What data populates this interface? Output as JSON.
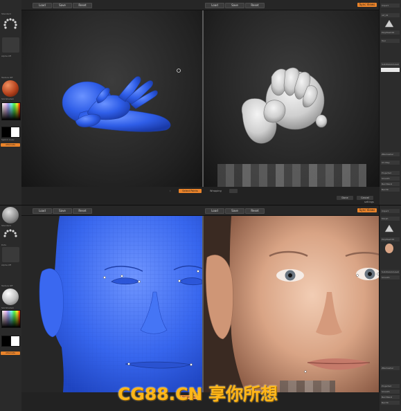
{
  "panels": [
    {
      "left_shelf": {
        "label_a": "Standard",
        "label_b": "Alpha Off",
        "label_c": "Texture Off",
        "label_d": "SkinShade4",
        "label_e": "Switch Color",
        "button": "Alternate"
      },
      "toolbar": {
        "load_a": "Load",
        "save_a": "Save",
        "reset_a": "Reset",
        "load_b": "Load",
        "save_b": "Save",
        "reset_b": "Reset",
        "sync": "Sync Views"
      },
      "bottombar": {
        "select_points": "Select Points",
        "wrapping": "Wrapping",
        "done": "Done",
        "cancel": "Cancel",
        "extra_a": "settings",
        "extra_b": "Wireframe"
      },
      "right_shelf": {
        "r1": "Import",
        "r2": "ref_02",
        "r3": "PolyMesh3D",
        "r4": "Tool",
        "r5": "SubdivisionLevel",
        "r6": "ZRemesher",
        "r7": "UV Map",
        "r8": "Projected",
        "r9": "Smooth",
        "r10": "Bad Blend",
        "r11": "Bad Bl"
      }
    },
    {
      "left_shelf": {
        "label_a": "Standard",
        "label_b": "Dots",
        "label_c": "Alpha Off",
        "label_d": "Texture Off",
        "label_e": "SkinShade4",
        "button": "Alternate"
      },
      "toolbar": {
        "load_a": "Load",
        "save_a": "Save",
        "reset_a": "Reset",
        "load_b": "Load",
        "save_b": "Save",
        "reset_b": "Reset",
        "sync": "Sync Views"
      },
      "bottombar": {
        "select_points": "Select Points"
      },
      "right_shelf": {
        "r1": "Import",
        "r2": "Morph",
        "r3": "PolyMesh3D",
        "r4": "SubdivisionLevel",
        "r5": "Smooth",
        "r6": "ZRemesher",
        "r7": "Projected",
        "r8": "Smooth",
        "r9": "Bad Blend",
        "r10": "Bad Bl"
      }
    }
  ],
  "watermark": "CG88.CN 享你所想",
  "colors": {
    "accent": "#e9832a",
    "mesh_blue": "#3a6df0",
    "watermark": "#ffb619"
  }
}
